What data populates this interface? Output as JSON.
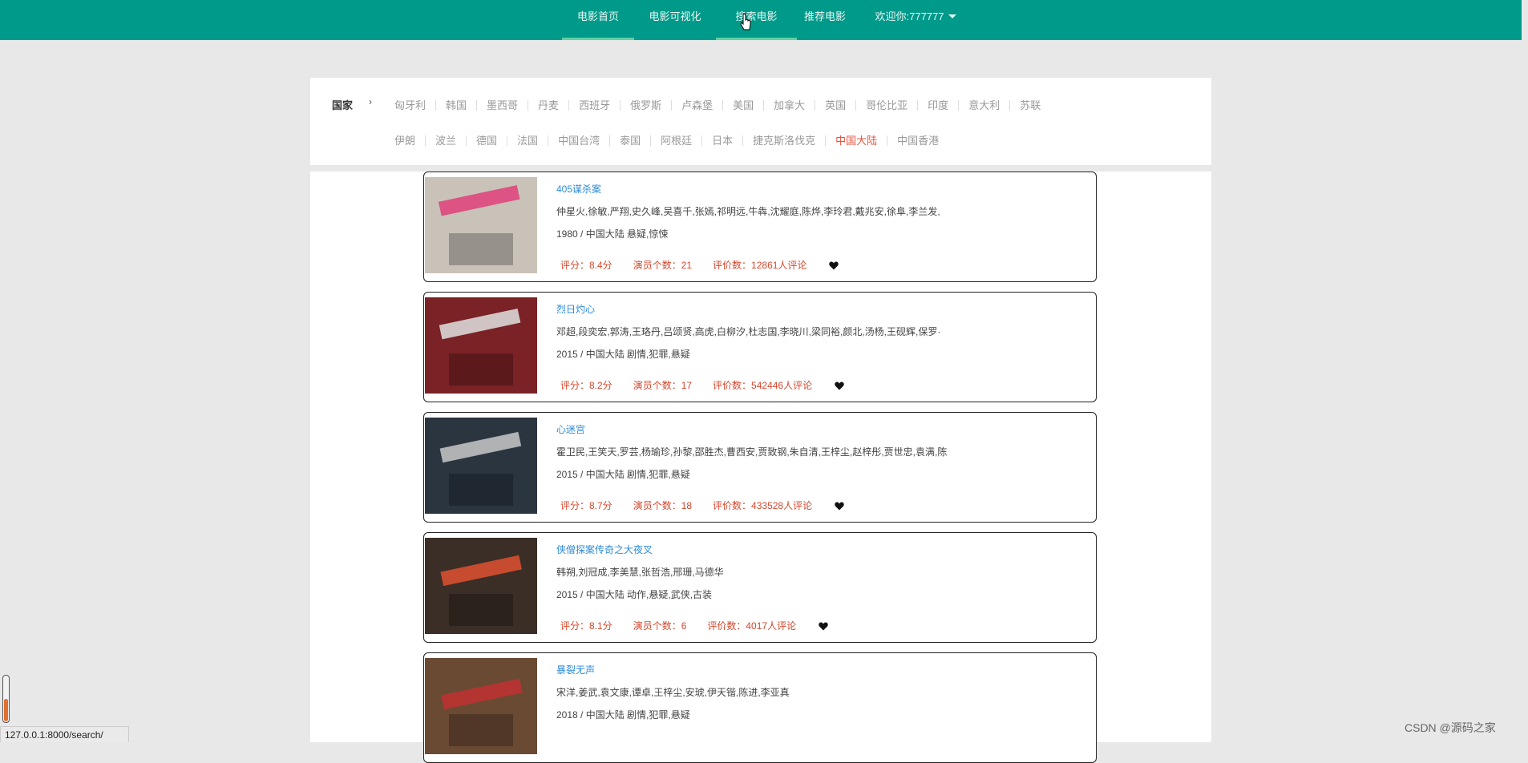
{
  "nav": {
    "items": [
      "电影首页",
      "电影可视化",
      "搜索电影",
      "推荐电影"
    ],
    "user_label": "欢迎你:777777",
    "accent": "#009a8a"
  },
  "filter": {
    "label": "国家",
    "arrow": "›",
    "countries_row1": [
      "匈牙利",
      "韩国",
      "墨西哥",
      "丹麦",
      "西班牙",
      "俄罗斯",
      "卢森堡",
      "美国",
      "加拿大",
      "英国",
      "哥伦比亚",
      "印度",
      "意大利",
      "苏联"
    ],
    "countries_row2": [
      "伊朗",
      "波兰",
      "德国",
      "法国",
      "中国台湾",
      "泰国",
      "阿根廷",
      "日本",
      "捷克斯洛伐克",
      "中国大陆",
      "中国香港"
    ],
    "active": "中国大陆"
  },
  "movies": [
    {
      "title": "405谋杀案",
      "actors": "仲星火,徐敏,严翔,史久峰,吴喜千,张嫣,祁明远,牛犇,沈耀庭,陈烨,李玲君,戴兆安,徐阜,李兰发,",
      "meta": "1980 / 中国大陆 悬疑,惊悚",
      "rating": "评分：8.4分",
      "actor_count": "演员个数：21",
      "reviews": "评价数：12861人评论"
    },
    {
      "title": "烈日灼心",
      "actors": "邓超,段奕宏,郭涛,王珞丹,吕颂贤,高虎,白柳汐,杜志国,李晓川,梁同裕,颜北,汤杨,王砚辉,保罗·",
      "meta": "2015 / 中国大陆 剧情,犯罪,悬疑",
      "rating": "评分：8.2分",
      "actor_count": "演员个数：17",
      "reviews": "评价数：542446人评论"
    },
    {
      "title": "心迷宫",
      "actors": "霍卫民,王笑天,罗芸,杨瑜珍,孙黎,邵胜杰,曹西安,贾致钢,朱自清,王梓尘,赵梓彤,贾世忠,袁满,陈",
      "meta": "2015 / 中国大陆 剧情,犯罪,悬疑",
      "rating": "评分：8.7分",
      "actor_count": "演员个数：18",
      "reviews": "评价数：433528人评论"
    },
    {
      "title": "侠僧探案传奇之大夜叉",
      "actors": "韩朔,刘冠成,李美慧,张哲浩,邢珊,马德华",
      "meta": "2015 / 中国大陆 动作,悬疑,武侠,古装",
      "rating": "评分：8.1分",
      "actor_count": "演员个数：6",
      "reviews": "评价数：4017人评论"
    },
    {
      "title": "暴裂无声",
      "actors": "宋洋,姜武,袁文康,谭卓,王梓尘,安琥,伊天锴,陈进,李亚真",
      "meta": "2018 / 中国大陆 剧情,犯罪,悬疑",
      "rating": "",
      "actor_count": "",
      "reviews": ""
    }
  ],
  "status_url": "127.0.0.1:8000/search/",
  "watermark": "CSDN @源码之家"
}
